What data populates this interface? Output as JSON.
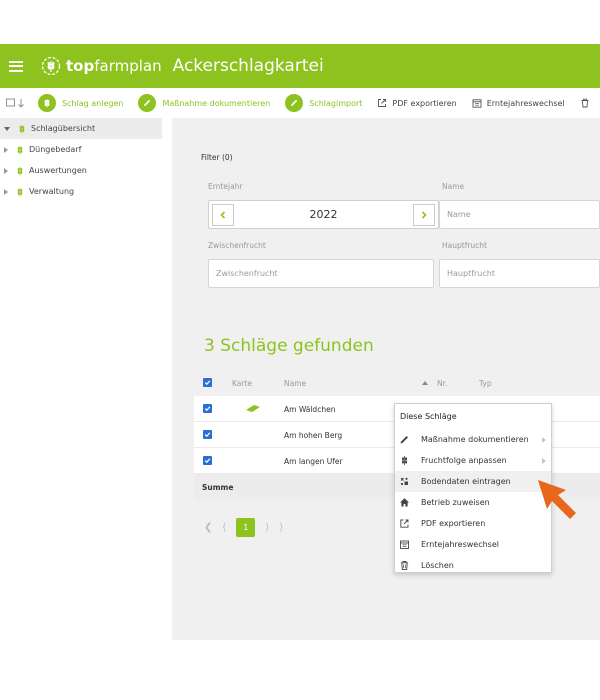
{
  "header": {
    "brand_bold": "top",
    "brand_regular": "farmplan",
    "title": "Ackerschlagkartei",
    "accent_color": "#8dc21f",
    "icons": [
      "menu-icon",
      "wheat-logo-icon"
    ]
  },
  "toolbar": {
    "items": [
      {
        "label": "Schlag anlegen",
        "icon": "wheat-icon"
      },
      {
        "label": "Maßnahme dokumentieren",
        "icon": "pencil-icon"
      },
      {
        "label": "Schlagimport",
        "icon": "pencil-icon"
      },
      {
        "label": "PDF exportieren",
        "icon": "export-icon"
      },
      {
        "label": "Erntejahreswechsel",
        "icon": "calendar-icon"
      }
    ]
  },
  "sidebar": {
    "items": [
      {
        "label": "Schlagübersicht"
      },
      {
        "label": "Düngebedarf"
      },
      {
        "label": "Auswertungen"
      },
      {
        "label": "Verwaltung"
      }
    ]
  },
  "filter": {
    "title": "Filter (0)",
    "year_label": "Erntejahr",
    "year_value": "2022",
    "name_label": "Name",
    "name_placeholder": "Name",
    "zwischenfrucht_label": "Zwischenfrucht",
    "zwischenfrucht_placeholder": "Zwischenfrucht",
    "hauptfrucht_label": "Hauptfrucht",
    "hauptfrucht_placeholder": "Hauptfrucht"
  },
  "results": {
    "heading": "3 Schläge gefunden",
    "columns": [
      "Karte",
      "Name",
      "Nr.",
      "Typ"
    ],
    "rows": [
      {
        "name": "Am Wäldchen",
        "checked": true,
        "has_map": true
      },
      {
        "name": "Am hohen Berg",
        "checked": true,
        "has_map": false
      },
      {
        "name": "Am langen Ufer",
        "checked": true,
        "has_map": false
      }
    ],
    "sum_label": "Summe"
  },
  "pagination": {
    "current": "1"
  },
  "context_menu": {
    "title": "Diese Schläge",
    "items": [
      {
        "label": "Maßnahme dokumentieren",
        "icon": "pencil-icon",
        "submenu": true
      },
      {
        "label": "Fruchtfolge anpassen",
        "icon": "wheat-icon",
        "submenu": true
      },
      {
        "label": "Bodendaten eintragen",
        "icon": "soil-icon",
        "highlighted": true
      },
      {
        "label": "Betrieb zuweisen",
        "icon": "home-icon"
      },
      {
        "label": "PDF exportieren",
        "icon": "export-icon"
      },
      {
        "label": "Erntejahreswechsel",
        "icon": "calendar-icon"
      },
      {
        "label": "Löschen",
        "icon": "trash-icon"
      }
    ]
  }
}
